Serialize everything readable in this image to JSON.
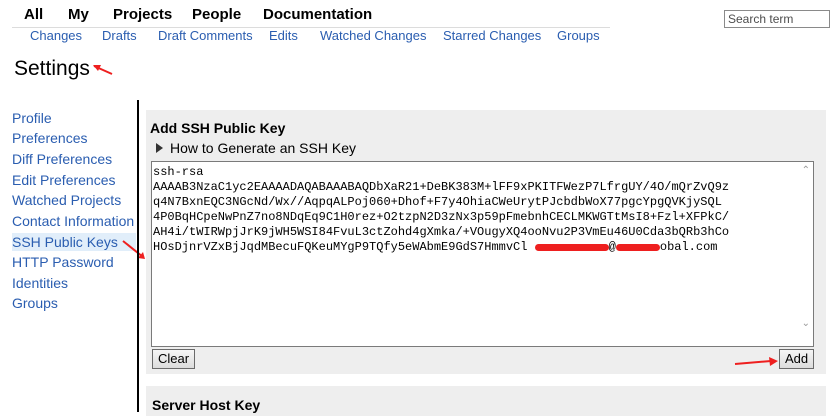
{
  "top_menu": [
    "All",
    "My",
    "Projects",
    "People",
    "Documentation"
  ],
  "search": {
    "placeholder": "Search term"
  },
  "sub_menu": [
    "Changes",
    "Drafts",
    "Draft Comments",
    "Edits",
    "Watched Changes",
    "Starred Changes",
    "Groups"
  ],
  "page_title": "Settings",
  "sidebar": {
    "items": [
      "Profile",
      "Preferences",
      "Diff Preferences",
      "Edit Preferences",
      "Watched Projects",
      "Contact Information",
      "SSH Public Keys",
      "HTTP Password",
      "Identities",
      "Groups"
    ],
    "active": "SSH Public Keys"
  },
  "ssh": {
    "title": "Add SSH Public Key",
    "howto": "How to Generate an SSH Key",
    "key_lines": [
      "ssh-rsa",
      "AAAAB3NzaC1yc2EAAAADAQABAAABAQDbXaR21+DeBK383M+lFF9xPKITFWezP7LfrgUY/4O/mQrZvQ9z",
      "q4N7BxnEQC3NGcNd/Wx//AqpqALPoj060+Dhof+F7y4OhiaCWeUrytPJcbdbWoX77pgcYpgQVKjySQL",
      "4P0BqHCpeNwPnZ7no8NDqEq9C1H0rez+O2tzpN2D3zNx3p59pFmebnhCECLMKWGTtMsI8+Fzl+XFPkC/",
      "AH4i/tWIRWpjJrK9jWH5WSI84FvuL3ctZohd4gXmka/+VOugyXQ4ooNvu2P3VmEu46U0Cda3bQRb3hCo",
      "HOsDjnrVZxBjJqdMBecuFQKeuMYgP9TQfy5eWAbmE9GdS7HmmvCl"
    ],
    "email_visible_at": "@",
    "email_visible_tail": "obal.com",
    "clear_label": "Clear",
    "add_label": "Add"
  },
  "host": {
    "title": "Server Host Key"
  },
  "colors": {
    "link": "#2a5db0",
    "active_bg": "#e1eefa",
    "panel_bg": "#eeeeee",
    "annotation": "#ee1f1f"
  }
}
